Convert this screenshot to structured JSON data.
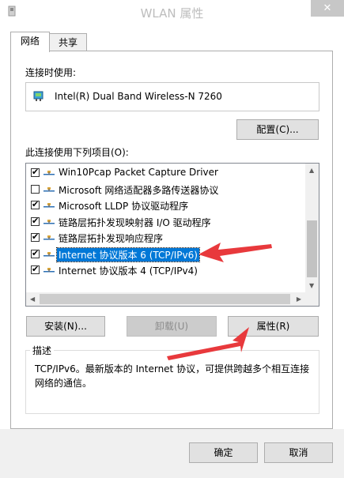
{
  "window": {
    "title": "WLAN 属性",
    "close_label": "✕"
  },
  "tabs": [
    {
      "label": "网络",
      "active": true
    },
    {
      "label": "共享",
      "active": false
    }
  ],
  "connect_using": {
    "label": "连接时使用:",
    "adapter_name": "Intel(R) Dual Band Wireless-N 7260",
    "configure_label": "配置(C)..."
  },
  "items": {
    "label": "此连接使用下列项目(O):",
    "list": [
      {
        "checked": true,
        "label": "Win10Pcap Packet Capture Driver",
        "selected": false
      },
      {
        "checked": false,
        "label": "Microsoft 网络适配器多路传送器协议",
        "selected": false
      },
      {
        "checked": true,
        "label": "Microsoft LLDP 协议驱动程序",
        "selected": false
      },
      {
        "checked": true,
        "label": "链路层拓扑发现映射器 I/O 驱动程序",
        "selected": false
      },
      {
        "checked": true,
        "label": "链路层拓扑发现响应程序",
        "selected": false
      },
      {
        "checked": true,
        "label": "Internet 协议版本 6 (TCP/IPv6)",
        "selected": true
      },
      {
        "checked": true,
        "label": "Internet 协议版本 4 (TCP/IPv4)",
        "selected": false
      }
    ]
  },
  "buttons": {
    "install": "安装(N)...",
    "uninstall": "卸载(U)",
    "properties": "属性(R)",
    "ok": "确定",
    "cancel": "取消"
  },
  "description": {
    "title": "描述",
    "text": "TCP/IPv6。最新版本的 Internet 协议，可提供跨越多个相互连接网络的通信。"
  },
  "colors": {
    "selection": "#0078d7",
    "annotation_arrow": "#e8393c"
  }
}
